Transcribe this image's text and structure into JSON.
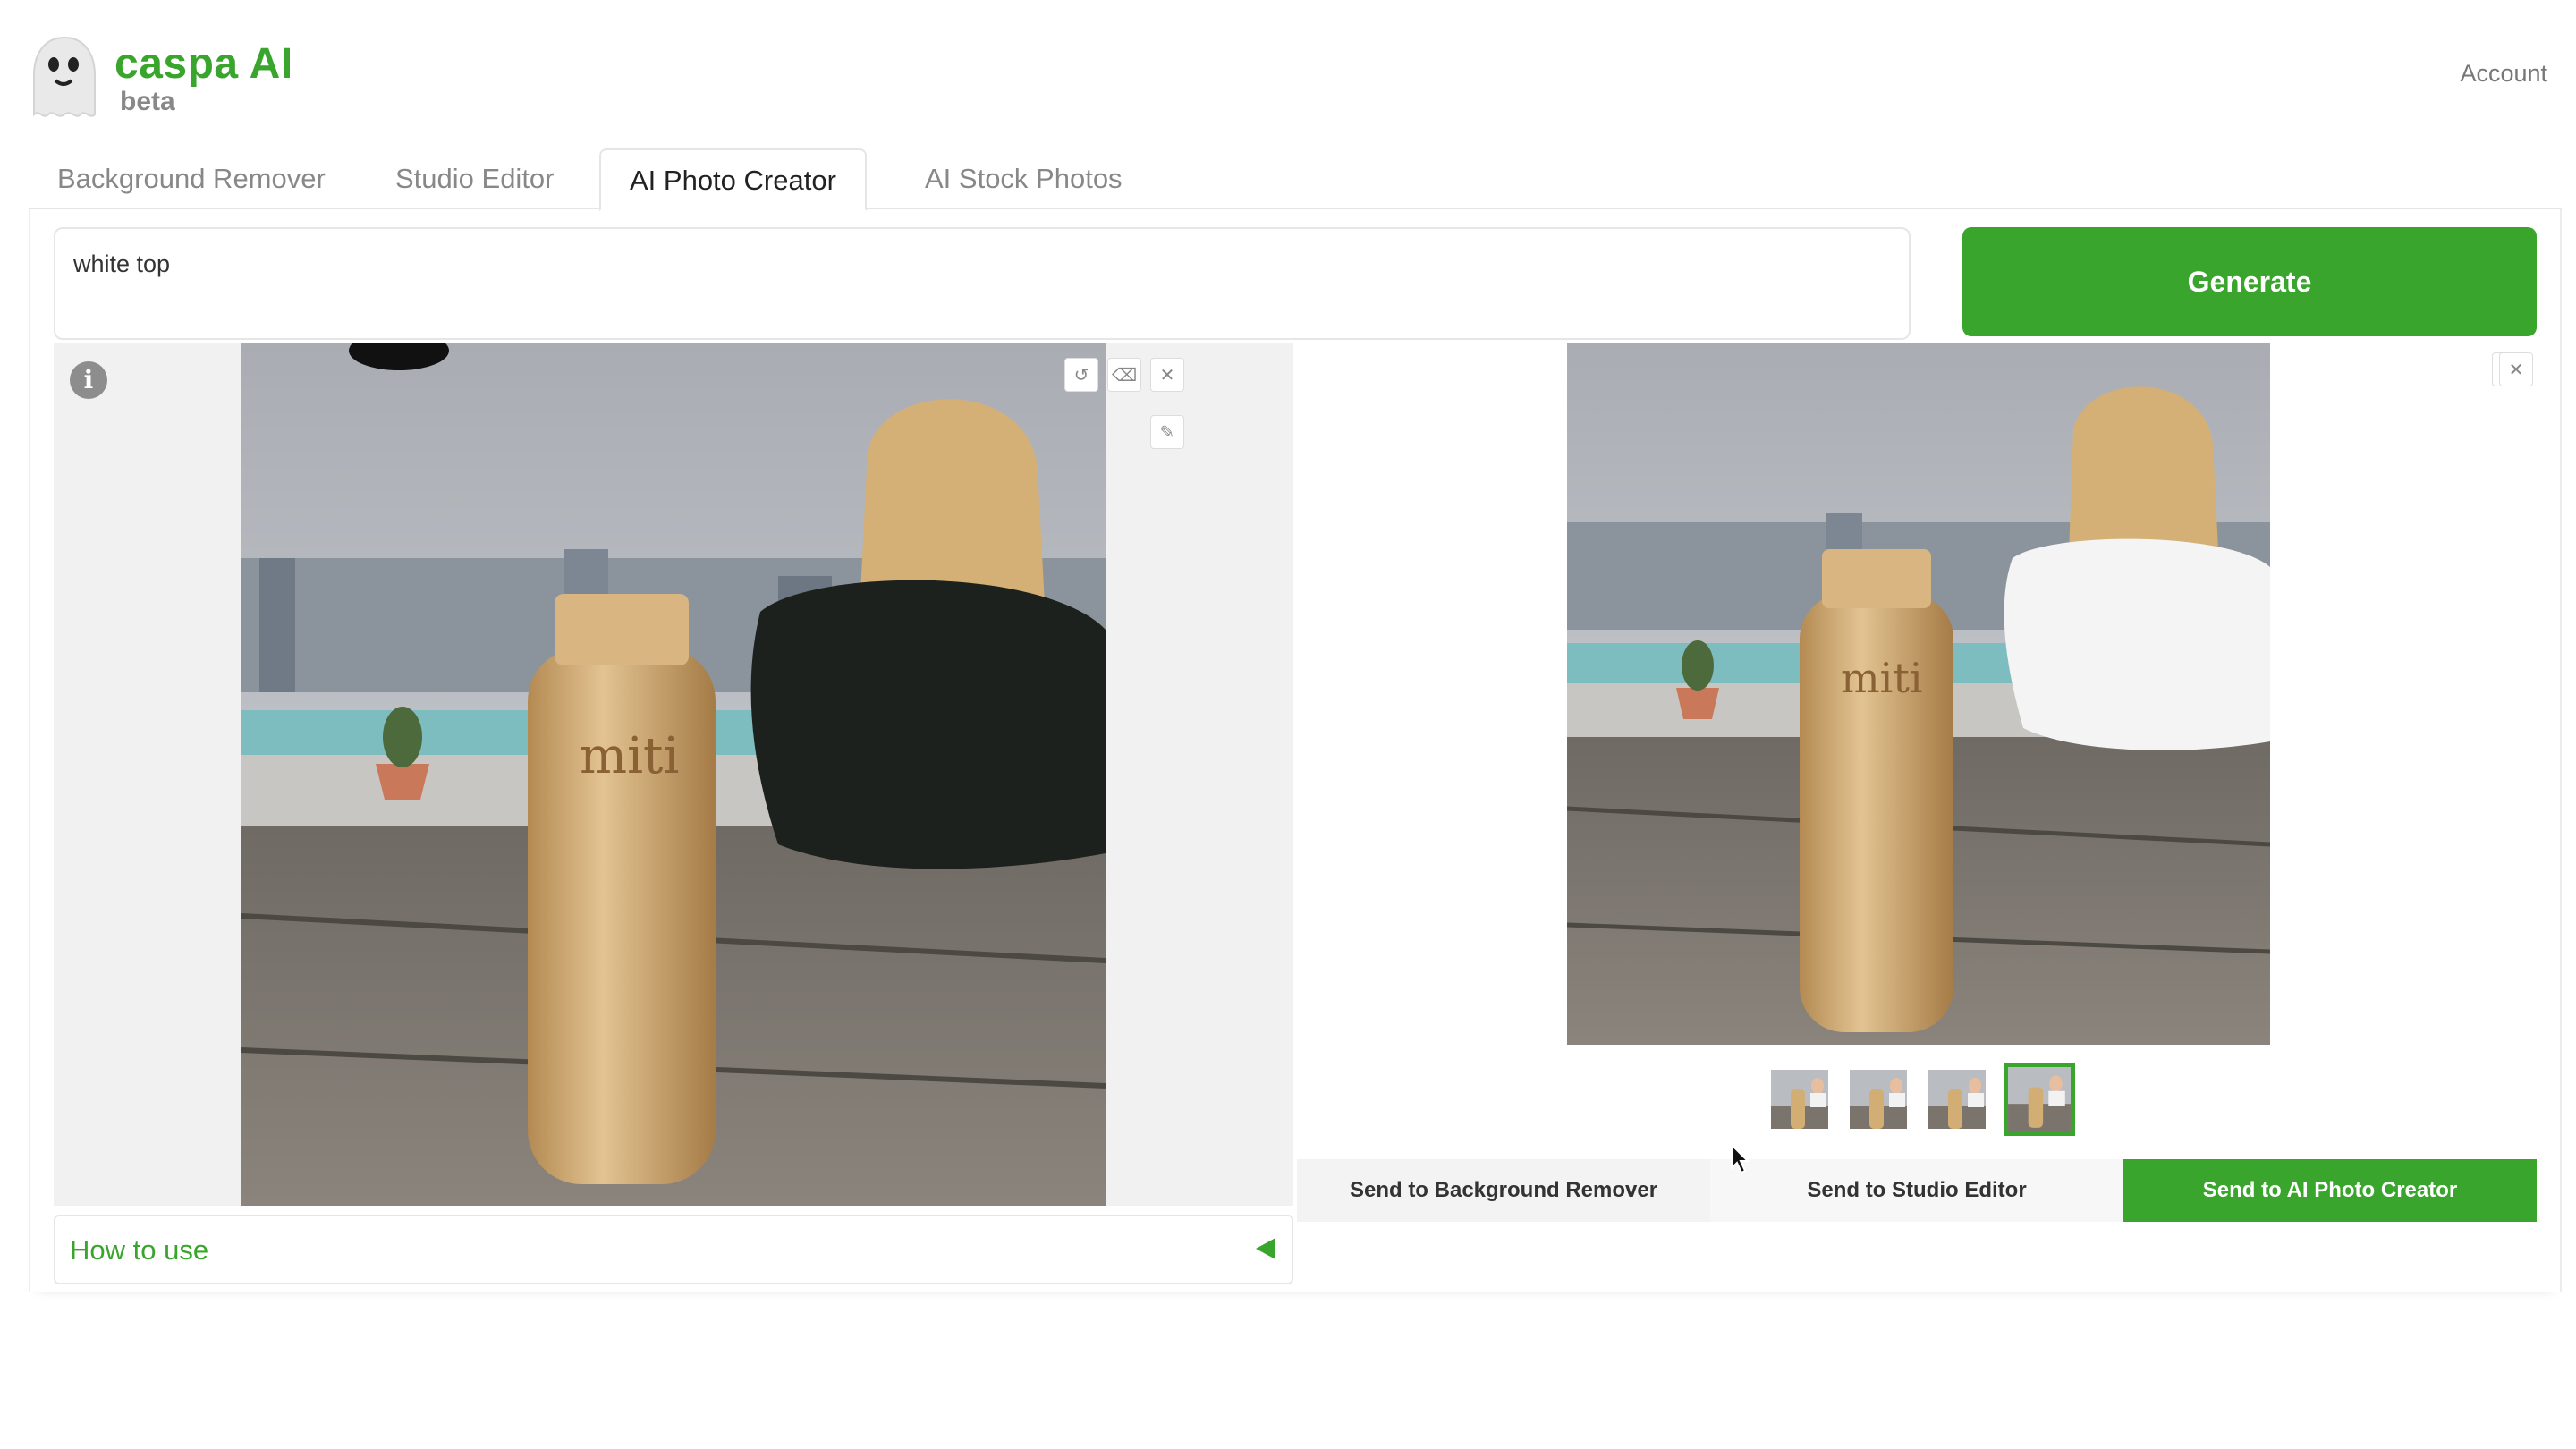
{
  "app": {
    "brand": "caspa AI",
    "badge": "beta",
    "account_label": "Account"
  },
  "tabs": [
    {
      "label": "Background Remover",
      "active": false
    },
    {
      "label": "Studio Editor",
      "active": false
    },
    {
      "label": "AI Photo Creator",
      "active": true
    },
    {
      "label": "AI Stock Photos",
      "active": false
    }
  ],
  "prompt": {
    "value": "white top"
  },
  "generate_label": "Generate",
  "editor": {
    "info_glyph": "i",
    "tools": [
      "undo-icon",
      "eraser-icon",
      "close-icon",
      "brush-icon"
    ]
  },
  "help": {
    "label": "How to use"
  },
  "result": {
    "selected_variant": 4,
    "variant_count": 4,
    "tools": [
      "download-icon",
      "close-icon"
    ]
  },
  "send_actions": [
    {
      "label": "Send to Background Remover",
      "primary": false
    },
    {
      "label": "Send to Studio Editor",
      "primary": false
    },
    {
      "label": "Send to AI Photo Creator",
      "primary": true
    }
  ],
  "colors": {
    "accent": "#3aa52c",
    "panel_gray": "#f1f1f1"
  }
}
